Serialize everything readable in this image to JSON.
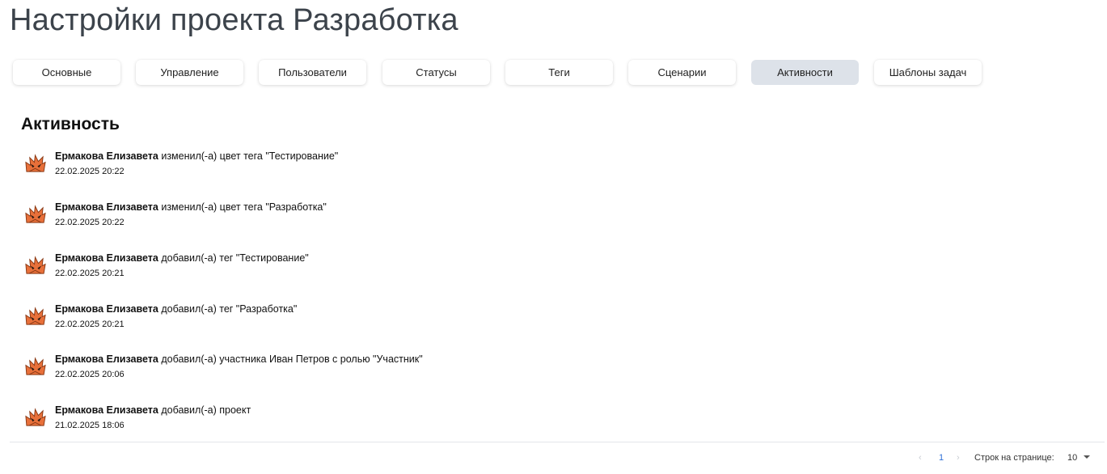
{
  "page": {
    "title": "Настройки проекта Разработка"
  },
  "tabs": [
    {
      "label": "Основные",
      "active": false
    },
    {
      "label": "Управление",
      "active": false
    },
    {
      "label": "Пользователи",
      "active": false
    },
    {
      "label": "Статусы",
      "active": false
    },
    {
      "label": "Теги",
      "active": false
    },
    {
      "label": "Сценарии",
      "active": false
    },
    {
      "label": "Активности",
      "active": true
    },
    {
      "label": "Шаблоны задач",
      "active": false
    }
  ],
  "section": {
    "title": "Активность"
  },
  "activities": [
    {
      "author": "Ермакова Елизавета",
      "action": " изменил(-а) цвет тега \"Тестирование\"",
      "time": "22.02.2025 20:22"
    },
    {
      "author": "Ермакова Елизавета",
      "action": " изменил(-а) цвет тега \"Разработка\"",
      "time": "22.02.2025 20:22"
    },
    {
      "author": "Ермакова Елизавета",
      "action": " добавил(-а) тег \"Тестирование\"",
      "time": "22.02.2025 20:21"
    },
    {
      "author": "Ермакова Елизавета",
      "action": " добавил(-а) тег \"Разработка\"",
      "time": "22.02.2025 20:21"
    },
    {
      "author": "Ермакова Елизавета",
      "action": " добавил(-а) участника Иван Петров с ролью \"Участник\"",
      "time": "22.02.2025 20:06"
    },
    {
      "author": "Ермакова Елизавета",
      "action": " добавил(-а) проект",
      "time": "21.02.2025 18:06"
    }
  ],
  "pagination": {
    "prev_icon": "‹",
    "current_page": "1",
    "next_icon": "›",
    "rows_label": "Строк на странице:",
    "rows_value": "10"
  },
  "colors": {
    "active_tab_bg": "#dde2e9",
    "page_link": "#2f6fd6",
    "avatar_fill": "#e8703a"
  }
}
